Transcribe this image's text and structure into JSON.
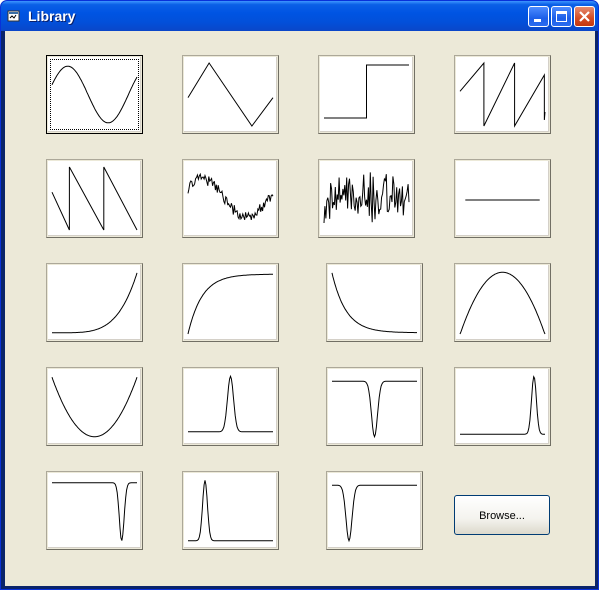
{
  "window": {
    "title": "Library",
    "buttons": [
      "minimize",
      "maximize",
      "close"
    ]
  },
  "library": {
    "waveforms": [
      "sine",
      "triangle",
      "square",
      "sawtooth",
      "reverse-sawtooth",
      "noisy-sine",
      "random-noise",
      "constant",
      "exponential-rise",
      "exponential-saturation",
      "exponential-decay",
      "inverted-parabola",
      "parabola",
      "gaussian-peak",
      "gaussian-dip",
      "gaussian-peak-right",
      "gaussian-dip-right",
      "gaussian-peak-left",
      "gaussian-dip-left"
    ],
    "selected": "sine",
    "browse_label": "Browse..."
  }
}
